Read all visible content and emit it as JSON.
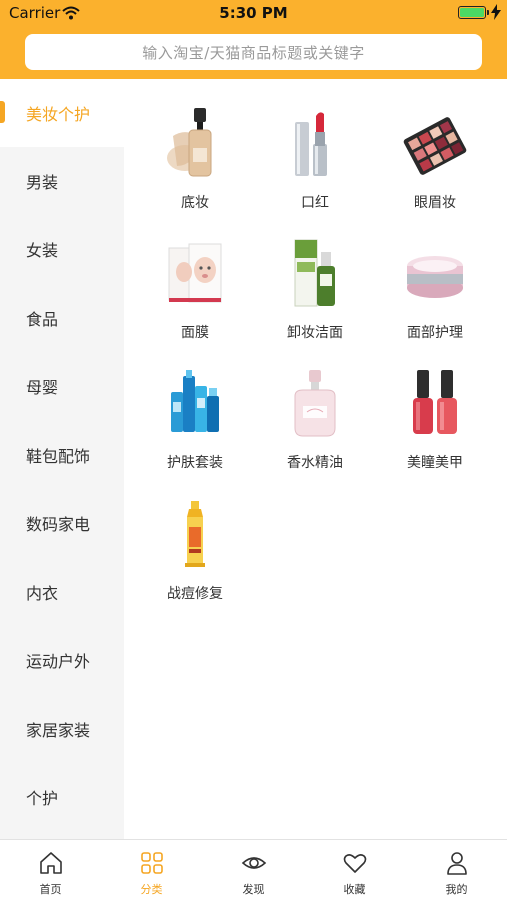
{
  "status_bar": {
    "carrier": "Carrier",
    "time": "5:30 PM"
  },
  "search": {
    "placeholder": "输入淘宝/天猫商品标题或关键字"
  },
  "sidebar": {
    "active_color": "#F5A623",
    "items": [
      {
        "label": "美妆个护",
        "active": true
      },
      {
        "label": "男装"
      },
      {
        "label": "女装"
      },
      {
        "label": "食品"
      },
      {
        "label": "母婴"
      },
      {
        "label": "鞋包配饰"
      },
      {
        "label": "数码家电"
      },
      {
        "label": "内衣"
      },
      {
        "label": "运动户外"
      },
      {
        "label": "家居家装"
      },
      {
        "label": "个护"
      }
    ]
  },
  "categories": [
    {
      "label": "底妆",
      "icon": "foundation-bottle-icon"
    },
    {
      "label": "口红",
      "icon": "lipstick-icon"
    },
    {
      "label": "眼眉妆",
      "icon": "eyeshadow-palette-icon"
    },
    {
      "label": "面膜",
      "icon": "face-mask-icon"
    },
    {
      "label": "卸妆洁面",
      "icon": "cleanser-icon"
    },
    {
      "label": "面部护理",
      "icon": "cream-jar-icon"
    },
    {
      "label": "护肤套装",
      "icon": "skincare-set-icon"
    },
    {
      "label": "香水精油",
      "icon": "perfume-bottle-icon"
    },
    {
      "label": "美瞳美甲",
      "icon": "nail-polish-icon"
    },
    {
      "label": "战痘修复",
      "icon": "acne-cream-tube-icon"
    }
  ],
  "tabbar": {
    "items": [
      {
        "label": "首页",
        "icon": "home-icon"
      },
      {
        "label": "分类",
        "icon": "grid-icon",
        "active": true
      },
      {
        "label": "发现",
        "icon": "eye-icon"
      },
      {
        "label": "收藏",
        "icon": "heart-icon"
      },
      {
        "label": "我的",
        "icon": "user-icon"
      }
    ]
  },
  "colors": {
    "header": "#FBB12D",
    "accent": "#F5A623",
    "sidebar_bg": "#F5F5F5"
  }
}
